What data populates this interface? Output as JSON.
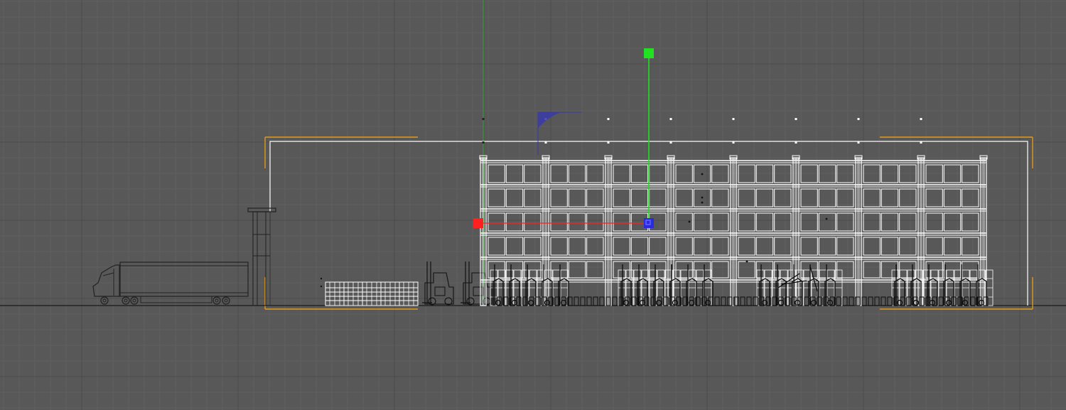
{
  "viewport": {
    "view": "orthographic-front",
    "background": "#585858",
    "grid_minor_color": "#5f5f5f",
    "grid_major_color": "#4c4c4c",
    "axis_color": "#1a1a1a",
    "wire_color": "#ffffff",
    "dark_wire_color": "#111111",
    "selection_color": "#e09a1a"
  },
  "gizmo": {
    "x_handle_color": "#ff2020",
    "y_handle_color": "#22e022",
    "z_handle_color": "#2a2ae0",
    "plane_handle_color": "#3a3aa8",
    "y_axis_line_color": "#2fa02f"
  },
  "scene_objects": [
    {
      "name": "truck",
      "icon": "semi-truck-wireframe"
    },
    {
      "name": "gate-pillar",
      "icon": "pillar-wireframe"
    },
    {
      "name": "pallet-stacks",
      "icon": "pallet-wireframe"
    },
    {
      "name": "forklifts",
      "icon": "forklift-wireframe"
    },
    {
      "name": "warehouse-rack",
      "icon": "rack-wireframe"
    },
    {
      "name": "lights",
      "icon": "light-point"
    }
  ]
}
